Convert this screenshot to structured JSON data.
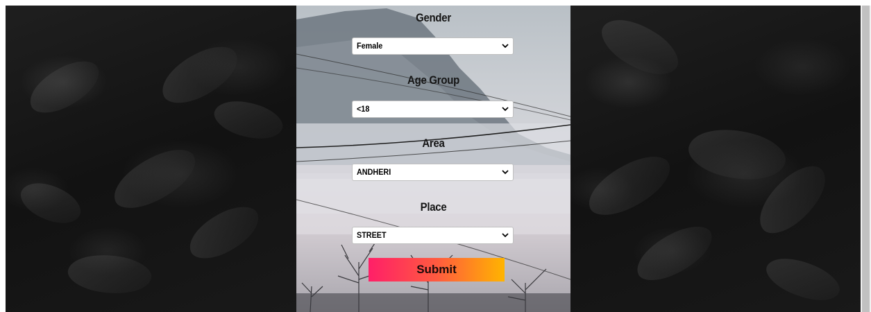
{
  "form": {
    "gender": {
      "label": "Gender",
      "value": "Female"
    },
    "age_group": {
      "label": "Age Group",
      "value": "<18"
    },
    "area": {
      "label": "Area",
      "value": "ANDHERI"
    },
    "place": {
      "label": "Place",
      "value": "STREET"
    },
    "submit_label": "Submit"
  },
  "colors": {
    "submit_gradient_start": "#ff1f68",
    "submit_gradient_end": "#ffb400",
    "background_dark": "#141414"
  }
}
